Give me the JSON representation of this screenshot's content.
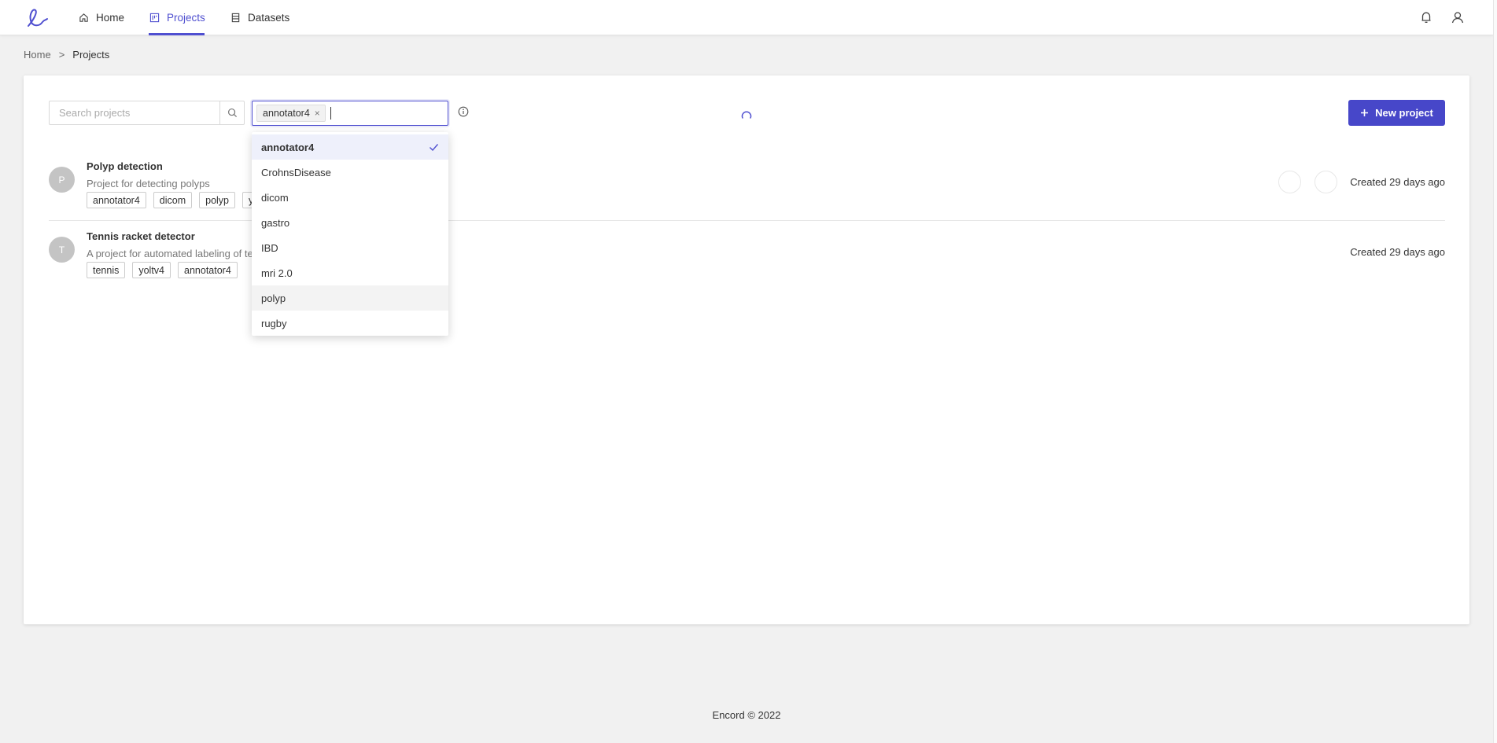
{
  "nav": {
    "items": [
      {
        "label": "Home",
        "icon": "home-icon"
      },
      {
        "label": "Projects",
        "icon": "projects-icon",
        "active": true
      },
      {
        "label": "Datasets",
        "icon": "datasets-icon"
      }
    ],
    "right_icons": [
      "bell-icon",
      "user-icon"
    ],
    "accent_color": "#4f4fd0"
  },
  "breadcrumb": {
    "root": "Home",
    "separator": ">",
    "current": "Projects"
  },
  "toolbar": {
    "search_placeholder": "Search projects",
    "selected_tags": [
      "annotator4"
    ],
    "new_project_label": "New project"
  },
  "tag_dropdown": {
    "options": [
      "annotator4",
      "CrohnsDisease",
      "dicom",
      "gastro",
      "IBD",
      "mri 2.0",
      "polyp",
      "rugby"
    ],
    "checked": "annotator4",
    "hovered": "polyp"
  },
  "projects": [
    {
      "initial": "P",
      "title": "Polyp detection",
      "description": "Project for detecting polyps",
      "tags": [
        "annotator4",
        "dicom",
        "polyp",
        "y"
      ],
      "created": "Created 29 days ago"
    },
    {
      "initial": "T",
      "title": "Tennis racket detector",
      "description": "A project for automated labeling of te",
      "tags": [
        "tennis",
        "yoltv4",
        "annotator4"
      ],
      "created": "Created 29 days ago"
    }
  ],
  "footer": "Encord © 2022"
}
